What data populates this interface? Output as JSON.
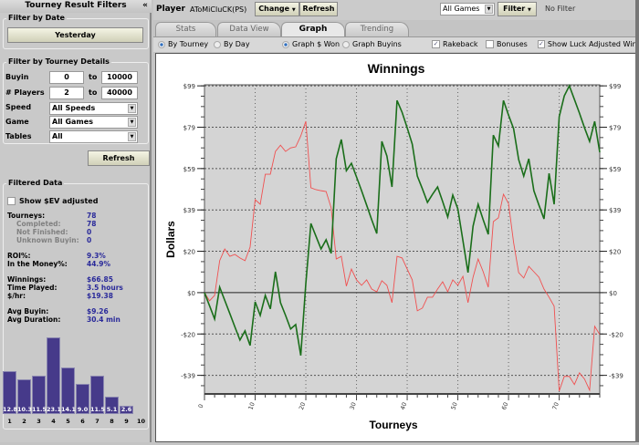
{
  "sidebar": {
    "title": "Tourney Result Filters",
    "collapse": "«",
    "date_group": "Filter by Date",
    "date_button": "Yesterday",
    "details_group": "Filter by Tourney Details",
    "buyin_label": "Buyin",
    "buyin_from": "0",
    "buyin_to": "10000",
    "players_label": "# Players",
    "players_from": "2",
    "players_to": "40000",
    "to": "to",
    "speed_label": "Speed",
    "speed_value": "All Speeds",
    "game_label": "Game",
    "game_value": "All Games",
    "tables_label": "Tables",
    "tables_value": "All",
    "refresh": "Refresh",
    "filtered_group": "Filtered Data",
    "ev_label": "Show $EV adjusted",
    "stats": [
      {
        "label": "Tourneys:",
        "value": "78",
        "sub": false
      },
      {
        "label": "Completed:",
        "value": "78",
        "sub": true
      },
      {
        "label": "Not Finished:",
        "value": "0",
        "sub": true
      },
      {
        "label": "Unknown Buyin:",
        "value": "0",
        "sub": true
      },
      {
        "label": "ROI%:",
        "value": "9.3%",
        "sub": false
      },
      {
        "label": "In the Money%:",
        "value": "44.9%",
        "sub": false
      },
      {
        "label": "Winnings:",
        "value": "$66.85",
        "sub": false
      },
      {
        "label": "Time Played:",
        "value": "3.5 hours",
        "sub": false
      },
      {
        "label": "$/hr:",
        "value": "$19.38",
        "sub": false
      },
      {
        "label": "Avg Buyin:",
        "value": "$9.26",
        "sub": false
      },
      {
        "label": "Avg Duration:",
        "value": "30.4 min",
        "sub": false
      }
    ],
    "histogram": {
      "categories": [
        "1",
        "2",
        "3",
        "4",
        "5",
        "6",
        "7",
        "8",
        "9",
        "10"
      ],
      "values": [
        12.8,
        10.3,
        11.5,
        23.1,
        14.1,
        9.0,
        11.5,
        5.1,
        2.6,
        null
      ],
      "labels": [
        "12.8",
        "10.3",
        "11.5",
        "23.1",
        "14.1",
        "9.0",
        "11.5",
        "5.1",
        "2.6",
        ""
      ],
      "color": "#463a8a"
    }
  },
  "topbar": {
    "player_label": "Player",
    "player_name": "AToMiCluCK(PS)",
    "change": "Change",
    "refresh": "Refresh",
    "games_select": "All Games",
    "filter": "Filter",
    "filter_status": "No Filter"
  },
  "tabs": [
    {
      "label": "Stats"
    },
    {
      "label": "Data View"
    },
    {
      "label": "Graph",
      "active": true
    },
    {
      "label": "Trending"
    }
  ],
  "options": {
    "by_tourney": "By Tourney",
    "by_day": "By Day",
    "graph_won": "Graph $ Won",
    "graph_buyins": "Graph Buyins",
    "rakeback": "Rakeback",
    "bonuses": "Bonuses",
    "luck": "Show Luck Adjusted Winnings"
  },
  "chart_data": {
    "type": "line",
    "title": "Winnings",
    "xlabel": "Tourneys",
    "ylabel": "Dollars",
    "xlim": [
      0,
      78
    ],
    "ylim": [
      -48.5,
      99.5
    ],
    "grid": true,
    "xticks": [
      0,
      10,
      20,
      30,
      40,
      50,
      60,
      70
    ],
    "yticks": [
      {
        "v": 99,
        "label": "$99"
      },
      {
        "v": 79.2,
        "label": "$79"
      },
      {
        "v": 59.4,
        "label": "$59"
      },
      {
        "v": 39.6,
        "label": "$39"
      },
      {
        "v": 19.8,
        "label": "$20"
      },
      {
        "v": 0,
        "label": "$0"
      },
      {
        "v": -19.8,
        "label": "-$20"
      },
      {
        "v": -39.6,
        "label": "-$39"
      }
    ],
    "series": [
      {
        "name": "Winnings",
        "color": "#1a6e1a",
        "values": [
          0,
          -6.3,
          -12.6,
          2.6,
          -3.7,
          -10,
          -16.4,
          -22.7,
          -18.3,
          -25.3,
          -4.4,
          -10.9,
          -1.3,
          -7.8,
          10,
          -4.8,
          -10.9,
          -17.4,
          -15.3,
          -30.1,
          4.4,
          33.1,
          27,
          20.9,
          25.3,
          18.8,
          64.1,
          73.3,
          58.4,
          61.9,
          55.4,
          48.8,
          41.9,
          34.9,
          28.3,
          72.4,
          65.4,
          50.6,
          92,
          86.3,
          78.9,
          71.1,
          55.8,
          49.7,
          43.2,
          47.1,
          50.6,
          43.6,
          36.2,
          46.7,
          40.1,
          24.9,
          9.6,
          31.8,
          42.3,
          34.9,
          27.9,
          75.4,
          70.2,
          92,
          85,
          78.5,
          63.7,
          55.8,
          64.1,
          48.8,
          41.9,
          35.3,
          57.1,
          42.3,
          84.2,
          94.2,
          99,
          92.5,
          85.9,
          78.9,
          72.4,
          82,
          67.2
        ]
      },
      {
        "name": "Luck Adjusted",
        "color": "#f05050",
        "values": [
          0,
          -3.9,
          -1.3,
          15.3,
          20.9,
          17.4,
          18.3,
          16.6,
          15.3,
          21.8,
          44.5,
          42.3,
          56.7,
          56.7,
          67.6,
          70.6,
          67.6,
          69.3,
          69.8,
          75,
          82,
          50.2,
          49.3,
          48.8,
          48.4,
          40.6,
          16.1,
          17.4,
          3.1,
          11.3,
          6.1,
          3.5,
          6.1,
          1.7,
          0.4,
          5.7,
          3.5,
          -4.8,
          17.4,
          16.6,
          11.3,
          6.1,
          -8.7,
          -7.4,
          -2.2,
          -2.2,
          1.7,
          5.2,
          0.4,
          6.1,
          3.5,
          7.8,
          -4.8,
          7.4,
          16.1,
          10,
          2.6,
          34,
          35.8,
          47.1,
          42.7,
          24,
          9.6,
          7,
          12.6,
          10,
          7.4,
          1.7,
          -2.2,
          -6.5,
          -47.1,
          -40.1,
          -40.1,
          -44,
          -38.4,
          -41.4,
          -46.7,
          -16.1,
          -20.1
        ]
      }
    ]
  }
}
